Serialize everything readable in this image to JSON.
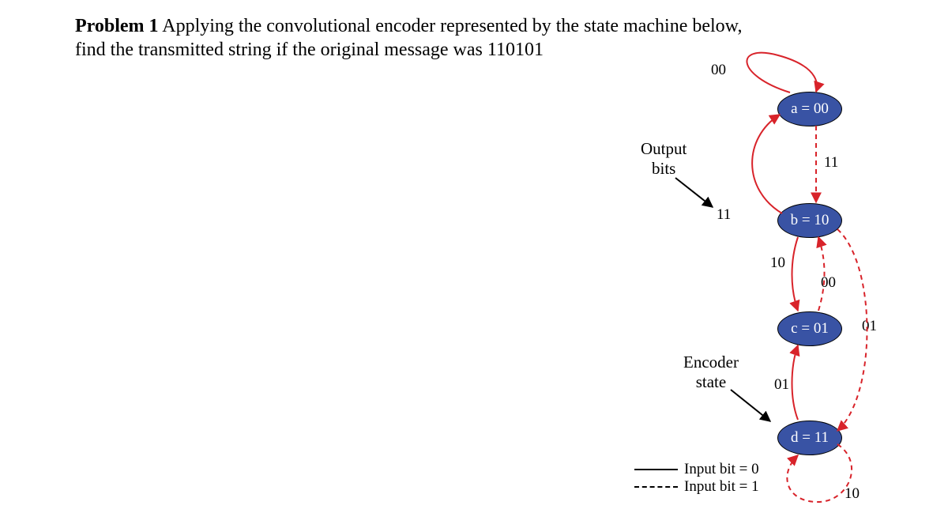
{
  "problem": {
    "label": "Problem 1",
    "text_line1": "Applying the convolutional encoder represented by the state machine below,",
    "text_line2": "find the transmitted string if the original message was 110101"
  },
  "states": {
    "a": "a = 00",
    "b": "b = 10",
    "c": "c = 01",
    "d": "d = 11"
  },
  "edge_labels": {
    "a_loop": "00",
    "a_to_b": "11",
    "b_to_a": "11",
    "b_to_c": "10",
    "b_to_d": "01",
    "c_to_b": "00",
    "d_to_c": "01",
    "d_loop": "10"
  },
  "annotations": {
    "output_bits": "Output",
    "output_bits2": "bits",
    "encoder_state": "Encoder",
    "encoder_state2": "state"
  },
  "legend": {
    "input0": "Input bit = 0",
    "input1": "Input bit = 1"
  },
  "chart_data": {
    "type": "state_machine",
    "title": "Convolutional encoder state diagram",
    "message": "110101",
    "states": [
      {
        "id": "a",
        "label": "a = 00"
      },
      {
        "id": "b",
        "label": "b = 10"
      },
      {
        "id": "c",
        "label": "c = 01"
      },
      {
        "id": "d",
        "label": "d = 11"
      }
    ],
    "transitions": [
      {
        "from": "a",
        "to": "a",
        "input": "0",
        "output": "00"
      },
      {
        "from": "a",
        "to": "b",
        "input": "1",
        "output": "11"
      },
      {
        "from": "b",
        "to": "a",
        "input": "0",
        "output": "11"
      },
      {
        "from": "b",
        "to": "d",
        "input": "1",
        "output": "01"
      },
      {
        "from": "b",
        "to": "c",
        "input": "0",
        "output": "10"
      },
      {
        "from": "c",
        "to": "b",
        "input": "1",
        "output": "00"
      },
      {
        "from": "d",
        "to": "c",
        "input": "0",
        "output": "01"
      },
      {
        "from": "d",
        "to": "d",
        "input": "1",
        "output": "10"
      }
    ],
    "legend": {
      "solid": "Input bit = 0",
      "dashed": "Input bit = 1"
    }
  }
}
